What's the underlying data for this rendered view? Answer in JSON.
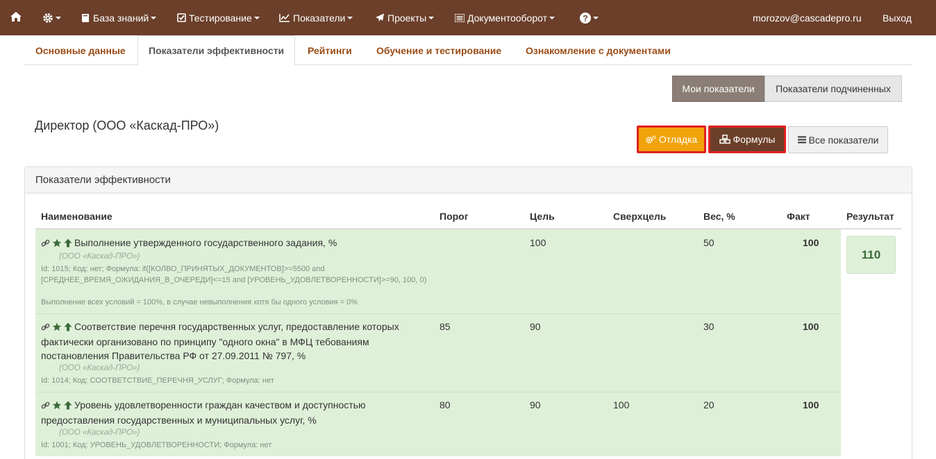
{
  "nav": {
    "knowledge": "База знаний",
    "testing": "Тестирование",
    "indicators": "Показатели",
    "projects": "Проекты",
    "docflow": "Документооборот",
    "email": "morozov@cascadepro.ru",
    "logout": "Выход"
  },
  "tabs": {
    "basic": "Основные данные",
    "kpi": "Показатели эффективности",
    "ratings": "Рейтинги",
    "training": "Обучение и тестирование",
    "docs": "Ознакомление с документами"
  },
  "toggle": {
    "my": "Мои показатели",
    "subordinates": "Показатели подчиненных"
  },
  "title": "Директор (ООО «Каскад-ПРО»)",
  "buttons": {
    "debug": "Отладка",
    "formulas": "Формулы",
    "all": "Все показатели"
  },
  "panel": {
    "heading": "Показатели эффективности"
  },
  "columns": {
    "name": "Наименование",
    "threshold": "Порог",
    "goal": "Цель",
    "supergoal": "Сверхцель",
    "weight": "Вес, %",
    "fact": "Факт",
    "result": "Результат"
  },
  "rows": [
    {
      "name": "Выполнение утвержденного государственного задания, %",
      "org": "(ООО «Каскад-ПРО»)",
      "meta": "Id: 1015; Код: нет; Формула: if([КОЛВО_ПРИНЯТЫХ_ДОКУМЕНТОВ]>=5500 and [СРЕДНЕЕ_ВРЕМЯ_ОЖИДАНИЯ_В_ОЧЕРЕДИ]<=15 and [УРОВЕНЬ_УДОВЛЕТВОРЕННОСТИ]>=90, 100, 0)",
      "note": "Выполнение всех условий = 100%, в случае невыполнения хотя бы одного условия = 0%",
      "threshold": "",
      "goal": "100",
      "supergoal": "",
      "weight": "50",
      "fact": "100"
    },
    {
      "name": "Соответствие перечня государственных услуг, предоставление которых фактически организовано по принципу \"одного окна\" в МФЦ тебованиям постановления Правительства РФ от 27.09.2011 № 797, %",
      "org": "(ООО «Каскад-ПРО»)",
      "meta": "Id: 1014; Код: СООТВЕТСТВИЕ_ПЕРЕЧНЯ_УСЛУГ; Формула: нет",
      "threshold": "85",
      "goal": "90",
      "supergoal": "",
      "weight": "30",
      "fact": "100"
    },
    {
      "name": "Уровень удовлетворенности граждан качеством и доступностью предоставления государственных и муниципальных услуг, %",
      "org": "(ООО «Каскад-ПРО»)",
      "meta": "Id: 1001; Код: УРОВЕНЬ_УДОВЛЕТВОРЕННОСТИ; Формула: нет",
      "threshold": "80",
      "goal": "90",
      "supergoal": "100",
      "weight": "20",
      "fact": "100"
    }
  ],
  "result": "110",
  "icons": {
    "home": "home-icon",
    "settings": "gear-icon",
    "knowledge": "book-icon",
    "testing": "check-square-icon",
    "indicators": "line-chart-icon",
    "projects": "paper-plane-icon",
    "docflow": "list-icon",
    "help": "question-icon",
    "debug": "cogs-icon",
    "formulas": "cubes-icon",
    "all": "bars-icon",
    "link": "link-icon",
    "star": "star-icon",
    "arrow_up": "arrow-up-icon"
  },
  "colors": {
    "navbar": "#6b3f2a",
    "tab_link": "#9a4c16",
    "row_bg": "#dff0d8",
    "debug_btn": "#f0a30a",
    "formulas_btn": "#6b3f2a",
    "highlight_border": "#e02020",
    "my_btn": "#8a7e76"
  }
}
